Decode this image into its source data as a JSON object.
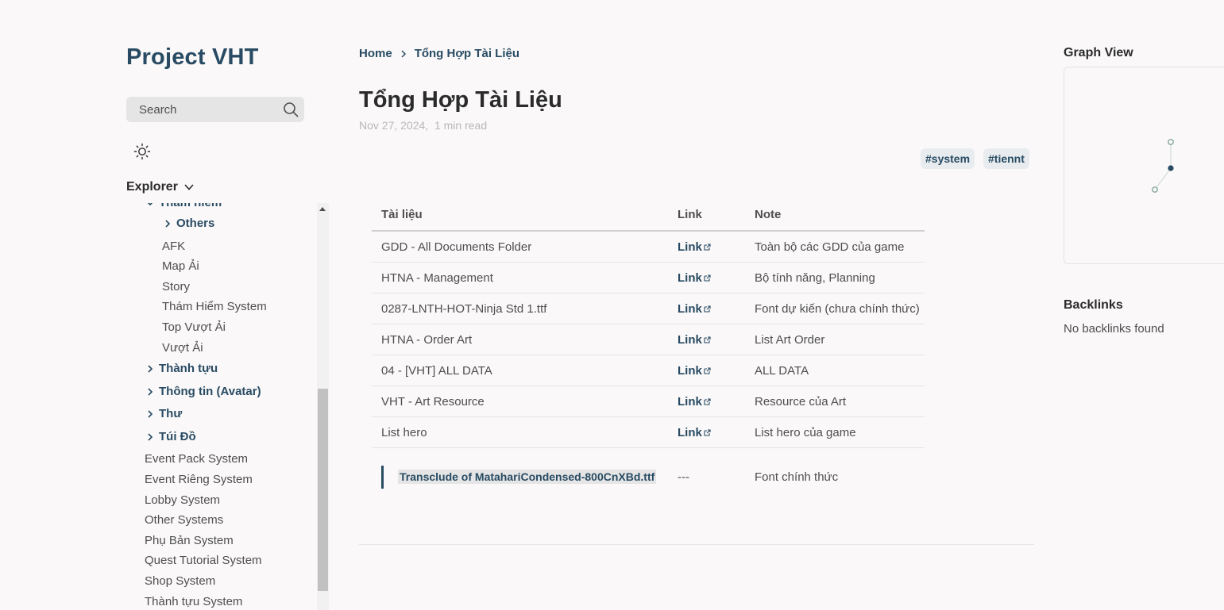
{
  "site": {
    "title": "Project VHT"
  },
  "search": {
    "placeholder": "Search"
  },
  "explorer": {
    "label": "Explorer",
    "partial_folder": "Thám hiểm",
    "items": [
      {
        "type": "folder",
        "label": "Others"
      },
      {
        "type": "file",
        "label": "AFK"
      },
      {
        "type": "file",
        "label": "Map Ải"
      },
      {
        "type": "file",
        "label": "Story"
      },
      {
        "type": "file",
        "label": "Thám Hiểm System"
      },
      {
        "type": "file",
        "label": "Top Vượt Ải"
      },
      {
        "type": "file",
        "label": "Vượt Ải"
      },
      {
        "type": "folder",
        "label": "Thành tựu"
      },
      {
        "type": "folder",
        "label": "Thông tin (Avatar)"
      },
      {
        "type": "folder",
        "label": "Thư"
      },
      {
        "type": "folder",
        "label": "Túi Đồ"
      },
      {
        "type": "file",
        "label": "Event Pack System"
      },
      {
        "type": "file",
        "label": "Event Riêng System"
      },
      {
        "type": "file",
        "label": "Lobby System"
      },
      {
        "type": "file",
        "label": "Other Systems"
      },
      {
        "type": "file",
        "label": "Phụ Bản System"
      },
      {
        "type": "file",
        "label": "Quest Tutorial System"
      },
      {
        "type": "file",
        "label": "Shop System"
      },
      {
        "type": "file",
        "label": "Thành tựu System"
      }
    ]
  },
  "breadcrumb": {
    "home": "Home",
    "current": "Tổng Hợp Tài Liệu"
  },
  "page": {
    "title": "Tổng Hợp Tài Liệu",
    "date": "Nov 27, 2024",
    "read_time": "1 min read",
    "tags": [
      "#system",
      "#tiennt"
    ]
  },
  "table": {
    "headers": [
      "Tài liệu",
      "Link",
      "Note"
    ],
    "rows": [
      {
        "doc": "GDD - All Documents Folder",
        "link": "Link",
        "note": "Toàn bộ các GDD của game"
      },
      {
        "doc": "HTNA - Management",
        "link": "Link",
        "note": "Bộ tính năng, Planning"
      },
      {
        "doc": "0287-LNTH-HOT-Ninja Std 1.ttf",
        "link": "Link",
        "note": "Font dự kiến (chưa chính thức)"
      },
      {
        "doc": "HTNA - Order Art",
        "link": "Link",
        "note": "List Art Order"
      },
      {
        "doc": "04 - [VHT] ALL DATA",
        "link": "Link",
        "note": "ALL DATA"
      },
      {
        "doc": "VHT - Art Resource",
        "link": "Link",
        "note": "Resource của Art"
      },
      {
        "doc": "List hero",
        "link": "Link",
        "note": "List hero của game"
      }
    ],
    "transclude_row": {
      "doc": "Transclude of MatahariCondensed-800CnXBd.ttf",
      "link": "---",
      "note": "Font chính thức"
    }
  },
  "graph": {
    "title": "Graph View"
  },
  "backlinks": {
    "title": "Backlinks",
    "empty": "No backlinks found"
  },
  "colors": {
    "accent": "#284b63",
    "background": "#faf8f8",
    "text": "#4e4e4e"
  }
}
